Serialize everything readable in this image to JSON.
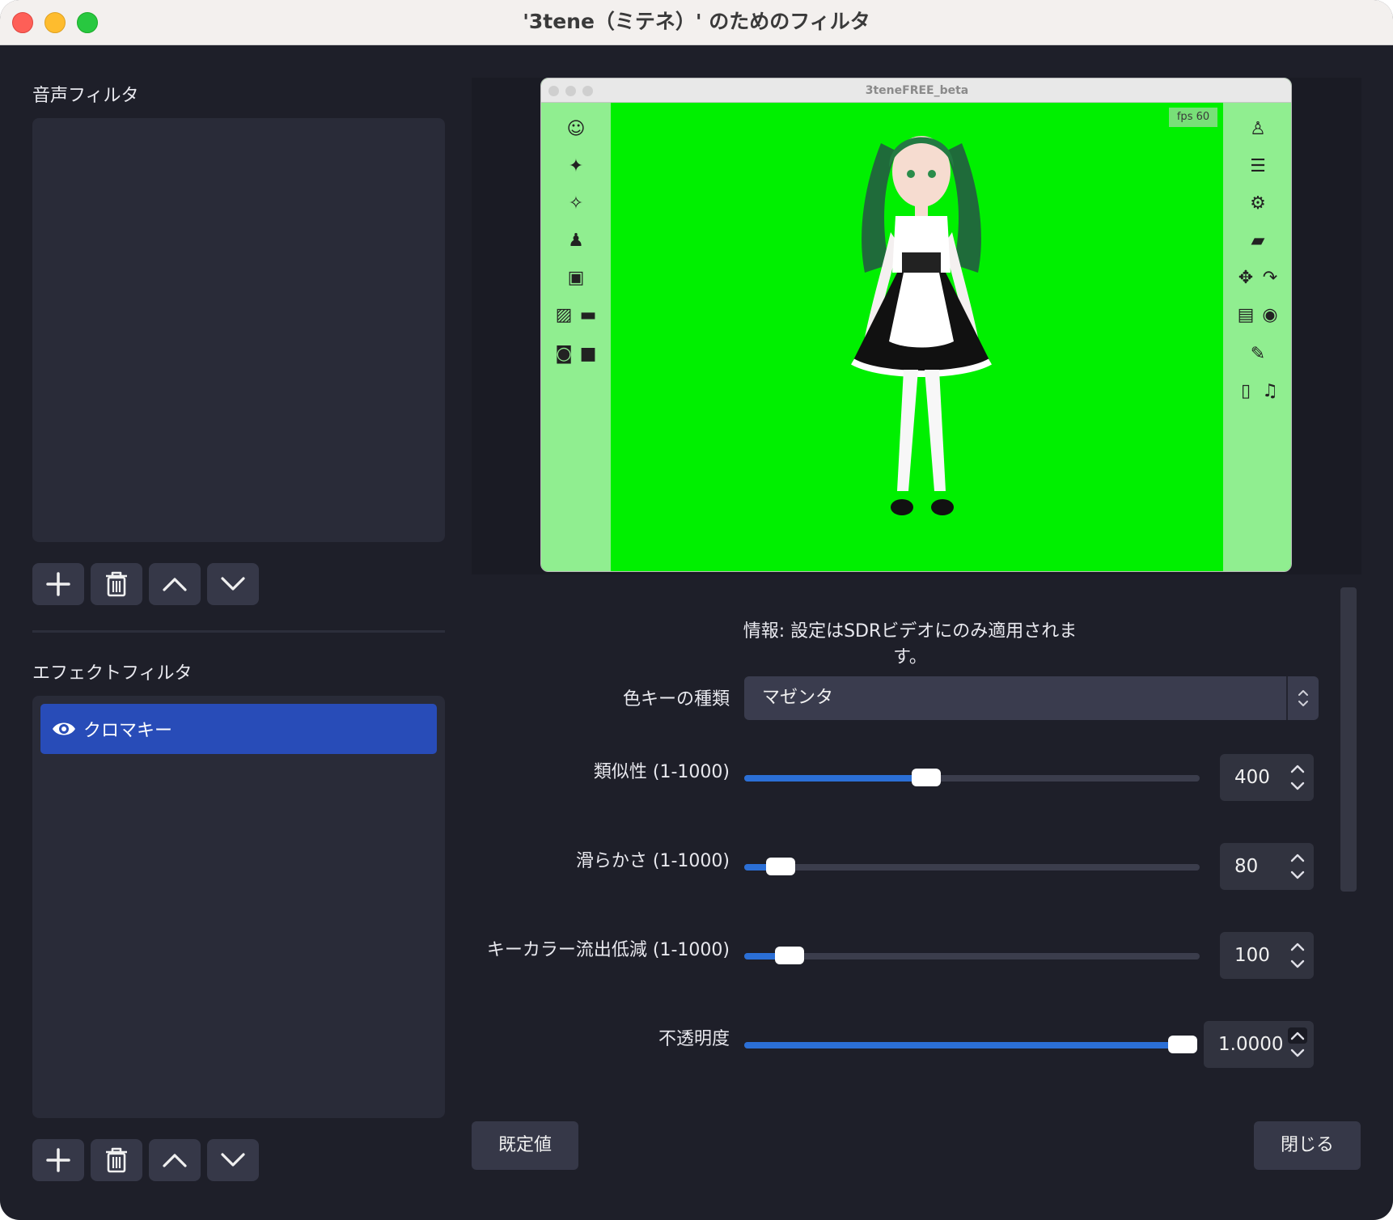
{
  "window": {
    "title": "'3tene（ミテネ）' のためのフィルタ"
  },
  "audio_filters": {
    "label": "音声フィルタ",
    "items": []
  },
  "effect_filters": {
    "label": "エフェクトフィルタ",
    "items": [
      {
        "label": "クロマキー",
        "visible": true,
        "selected": true
      }
    ]
  },
  "toolbar_icons": [
    "plus-icon",
    "trash-icon",
    "chevron-up-icon",
    "chevron-down-icon"
  ],
  "preview": {
    "app_title": "3teneFREE_beta",
    "fps_label": "fps  60",
    "background_color": "#00f000"
  },
  "properties": {
    "info": "情報: 設定はSDRビデオにのみ適用されます。",
    "key_color_type": {
      "label": "色キーの種類",
      "value": "マゼンタ"
    },
    "similarity": {
      "label": "類似性 (1-1000)",
      "value": "400",
      "level": 400,
      "min": 1,
      "max": 1000
    },
    "smoothness": {
      "label": "滑らかさ (1-1000)",
      "value": "80",
      "level": 80,
      "min": 1,
      "max": 1000
    },
    "spill_reduction": {
      "label": "キーカラー流出低減 (1-1000)",
      "value": "100",
      "level": 100,
      "min": 1,
      "max": 1000
    },
    "opacity": {
      "label": "不透明度",
      "value": "1.0000",
      "level": 1.0,
      "min": 0,
      "max": 1
    }
  },
  "buttons": {
    "defaults": "既定値",
    "close": "閉じる"
  },
  "colors": {
    "accent": "#284cb8",
    "slider_fill": "#2b6fd6",
    "window_bg": "#1e1f29"
  }
}
